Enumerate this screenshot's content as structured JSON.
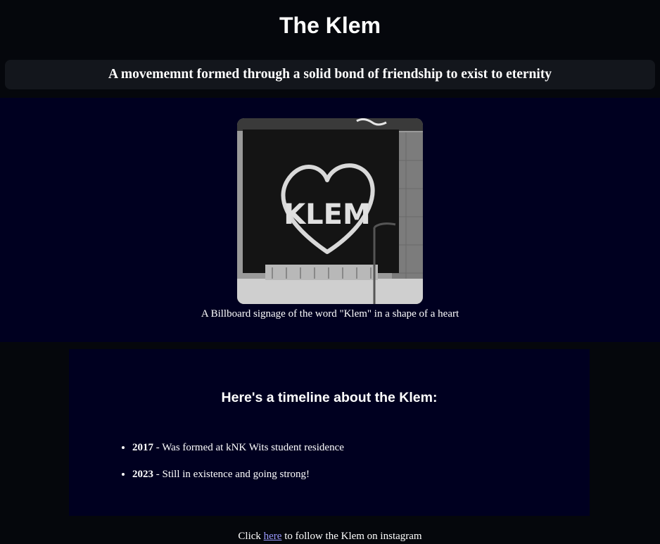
{
  "header": {
    "title": "The Klem",
    "tagline": "A movememnt formed through a solid bond of friendship to exist to eternity"
  },
  "hero": {
    "image_name": "klem-billboard-image",
    "image_text": "KLEM",
    "caption": "A Billboard signage of the word \"Klem\" in a shape of a heart"
  },
  "timeline": {
    "heading": "Here's a timeline about the Klem:",
    "items": [
      {
        "year": "2017",
        "text": " - Was formed at kNK Wits student residence"
      },
      {
        "year": "2023",
        "text": " - Still in existence and going strong!"
      }
    ]
  },
  "footer": {
    "prefix": "Click ",
    "link_text": "here",
    "suffix": " to follow the Klem on instagram"
  },
  "colors": {
    "page_bg": "#05070c",
    "section_bg": "#000020",
    "tagline_bg": "#13161c",
    "link": "#9a9aff"
  }
}
